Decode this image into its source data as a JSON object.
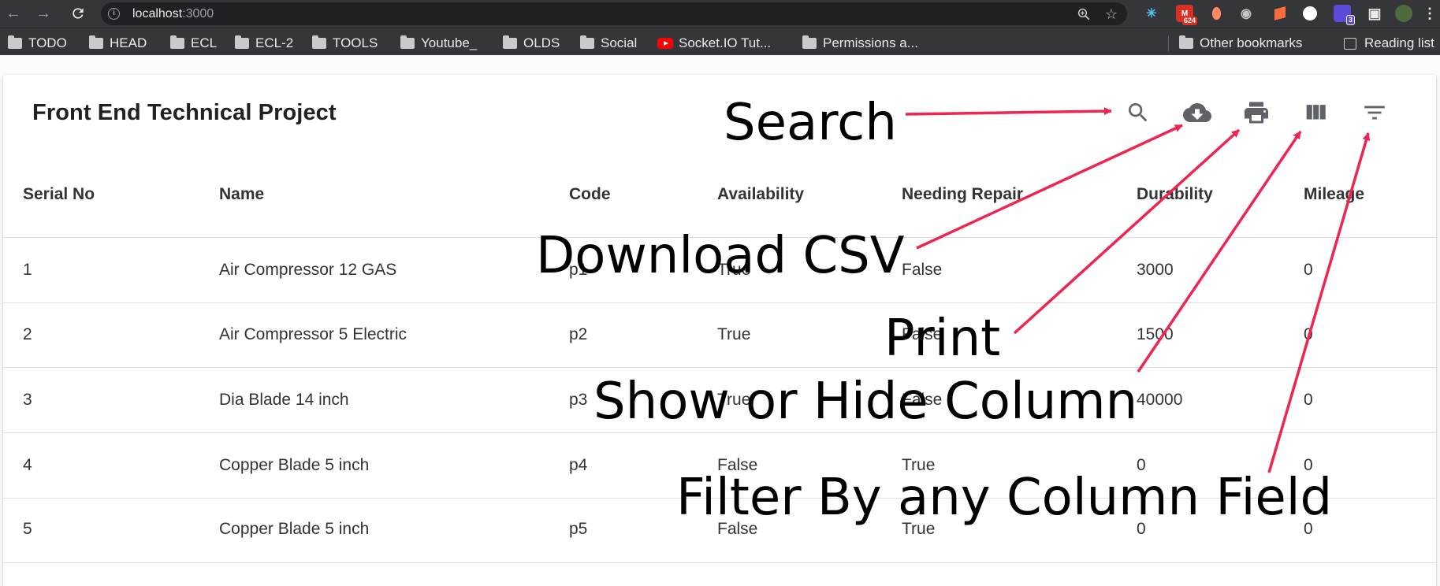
{
  "browser": {
    "url_host": "localhost",
    "url_port": ":3000",
    "extensions": [
      {
        "icon": "ai-sparkle-icon"
      },
      {
        "icon": "gmail-icon",
        "badge": "624"
      },
      {
        "icon": "fire-icon"
      },
      {
        "icon": "camera-icon"
      },
      {
        "icon": "postman-icon"
      },
      {
        "icon": "clock-icon"
      },
      {
        "icon": "purple-extension-icon",
        "badge": "3"
      },
      {
        "icon": "puzzle-icon"
      },
      {
        "icon": "profile-avatar"
      }
    ],
    "bookmarks": [
      "TODO",
      "HEAD",
      "ECL",
      "ECL-2",
      "TOOLS",
      "Youtube_",
      "OLDS",
      "Social",
      "Socket.IO Tut...",
      "Permissions a..."
    ],
    "other_bookmarks": "Other bookmarks",
    "reading_list": "Reading list"
  },
  "page": {
    "title": "Front End Technical Project",
    "toolbar": [
      "search",
      "download-csv",
      "print",
      "view-columns",
      "filter"
    ]
  },
  "table": {
    "columns": [
      "Serial No",
      "Name",
      "Code",
      "Availability",
      "Needing Repair",
      "Durability",
      "Mileage"
    ],
    "rows": [
      [
        "1",
        "Air Compressor 12 GAS",
        "p1",
        "True",
        "False",
        "3000",
        "0"
      ],
      [
        "2",
        "Air Compressor 5 Electric",
        "p2",
        "True",
        "False",
        "1500",
        "0"
      ],
      [
        "3",
        "Dia Blade 14 inch",
        "p3",
        "True",
        "False",
        "40000",
        "0"
      ],
      [
        "4",
        "Copper Blade 5 inch",
        "p4",
        "False",
        "True",
        "0",
        "0"
      ],
      [
        "5",
        "Copper Blade 5 inch",
        "p5",
        "False",
        "True",
        "0",
        "0"
      ]
    ]
  },
  "annotations": {
    "search": "Search",
    "download": "Download CSV",
    "print": "Print",
    "columns": "Show or Hide Column",
    "filter": "Filter By any Column Field"
  },
  "colors": {
    "arrow": "#f0254f",
    "chrome": "#35363a",
    "toolbar_icon": "#5f6368"
  }
}
